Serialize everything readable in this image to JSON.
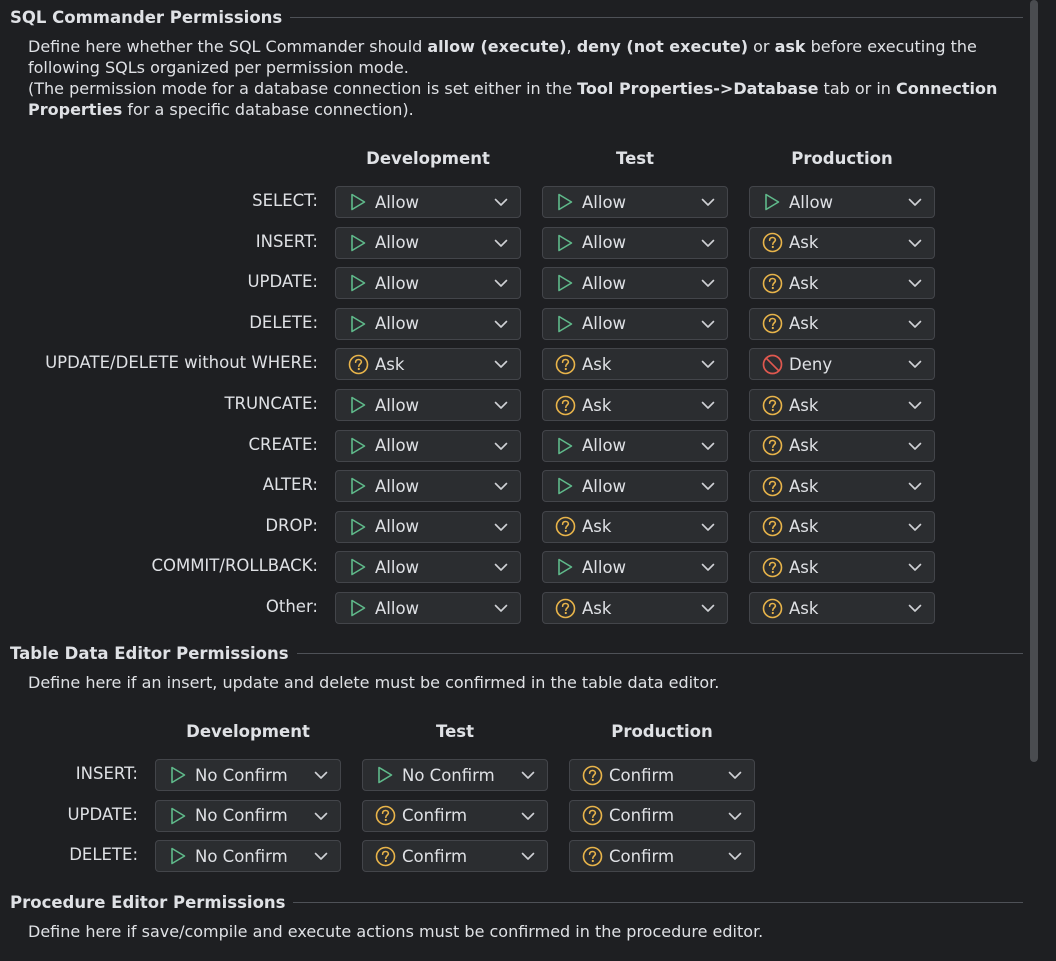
{
  "sql": {
    "title": "SQL Commander Permissions",
    "desc_parts": [
      "Define here whether the SQL Commander should ",
      "allow (execute)",
      ", ",
      "deny (not execute)",
      " or ",
      "ask",
      " before executing the following SQLs organized per permission mode."
    ],
    "desc2_parts": [
      "(The permission mode for a database connection is set either in the ",
      "Tool Properties->Database",
      " tab or in ",
      "Connection Properties",
      " for a specific database connection)."
    ],
    "columns": [
      "Development",
      "Test",
      "Production"
    ],
    "rows": [
      {
        "label": "SELECT:",
        "values": [
          {
            "text": "Allow",
            "icon": "play-icon"
          },
          {
            "text": "Allow",
            "icon": "play-icon"
          },
          {
            "text": "Allow",
            "icon": "play-icon"
          }
        ]
      },
      {
        "label": "INSERT:",
        "values": [
          {
            "text": "Allow",
            "icon": "play-icon"
          },
          {
            "text": "Allow",
            "icon": "play-icon"
          },
          {
            "text": "Ask",
            "icon": "question-icon"
          }
        ]
      },
      {
        "label": "UPDATE:",
        "values": [
          {
            "text": "Allow",
            "icon": "play-icon"
          },
          {
            "text": "Allow",
            "icon": "play-icon"
          },
          {
            "text": "Ask",
            "icon": "question-icon"
          }
        ]
      },
      {
        "label": "DELETE:",
        "values": [
          {
            "text": "Allow",
            "icon": "play-icon"
          },
          {
            "text": "Allow",
            "icon": "play-icon"
          },
          {
            "text": "Ask",
            "icon": "question-icon"
          }
        ]
      },
      {
        "label": "UPDATE/DELETE without WHERE:",
        "values": [
          {
            "text": "Ask",
            "icon": "question-icon"
          },
          {
            "text": "Ask",
            "icon": "question-icon"
          },
          {
            "text": "Deny",
            "icon": "deny-icon"
          }
        ]
      },
      {
        "label": "TRUNCATE:",
        "values": [
          {
            "text": "Allow",
            "icon": "play-icon"
          },
          {
            "text": "Ask",
            "icon": "question-icon"
          },
          {
            "text": "Ask",
            "icon": "question-icon"
          }
        ]
      },
      {
        "label": "CREATE:",
        "values": [
          {
            "text": "Allow",
            "icon": "play-icon"
          },
          {
            "text": "Allow",
            "icon": "play-icon"
          },
          {
            "text": "Ask",
            "icon": "question-icon"
          }
        ]
      },
      {
        "label": "ALTER:",
        "values": [
          {
            "text": "Allow",
            "icon": "play-icon"
          },
          {
            "text": "Allow",
            "icon": "play-icon"
          },
          {
            "text": "Ask",
            "icon": "question-icon"
          }
        ]
      },
      {
        "label": "DROP:",
        "values": [
          {
            "text": "Allow",
            "icon": "play-icon"
          },
          {
            "text": "Ask",
            "icon": "question-icon"
          },
          {
            "text": "Ask",
            "icon": "question-icon"
          }
        ]
      },
      {
        "label": "COMMIT/ROLLBACK:",
        "values": [
          {
            "text": "Allow",
            "icon": "play-icon"
          },
          {
            "text": "Allow",
            "icon": "play-icon"
          },
          {
            "text": "Ask",
            "icon": "question-icon"
          }
        ]
      },
      {
        "label": "Other:",
        "values": [
          {
            "text": "Allow",
            "icon": "play-icon"
          },
          {
            "text": "Ask",
            "icon": "question-icon"
          },
          {
            "text": "Ask",
            "icon": "question-icon"
          }
        ]
      }
    ]
  },
  "table_editor": {
    "title": "Table Data Editor Permissions",
    "desc": "Define here if an insert, update and delete must be confirmed in the table data editor.",
    "columns": [
      "Development",
      "Test",
      "Production"
    ],
    "rows": [
      {
        "label": "INSERT:",
        "values": [
          {
            "text": "No Confirm",
            "icon": "play-icon"
          },
          {
            "text": "No Confirm",
            "icon": "play-icon"
          },
          {
            "text": "Confirm",
            "icon": "question-icon"
          }
        ]
      },
      {
        "label": "UPDATE:",
        "values": [
          {
            "text": "No Confirm",
            "icon": "play-icon"
          },
          {
            "text": "Confirm",
            "icon": "question-icon"
          },
          {
            "text": "Confirm",
            "icon": "question-icon"
          }
        ]
      },
      {
        "label": "DELETE:",
        "values": [
          {
            "text": "No Confirm",
            "icon": "play-icon"
          },
          {
            "text": "Confirm",
            "icon": "question-icon"
          },
          {
            "text": "Confirm",
            "icon": "question-icon"
          }
        ]
      }
    ]
  },
  "procedure_editor": {
    "title": "Procedure Editor Permissions",
    "desc": "Define here if save/compile and execute actions must be confirmed in the procedure editor."
  },
  "colors": {
    "allow": "#5fb98a",
    "ask": "#e8b44a",
    "deny": "#e0584f"
  }
}
